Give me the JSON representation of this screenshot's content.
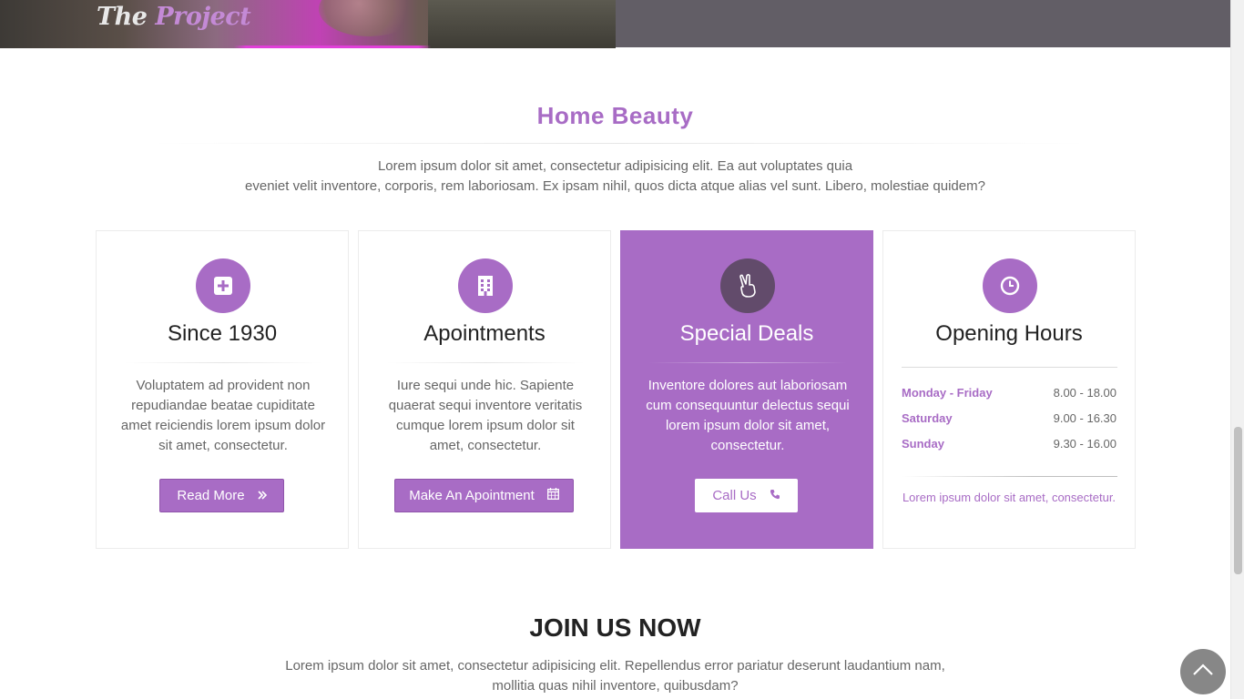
{
  "header": {
    "logo_part1": "The ",
    "logo_part2": "Project"
  },
  "section": {
    "title": "Home Beauty",
    "intro_line1": "Lorem ipsum dolor sit amet, consectetur adipisicing elit. Ea aut voluptates quia",
    "intro_line2": "eveniet velit inventore, corporis, rem laboriosam. Ex ipsam nihil, quos dicta atque alias vel sunt. Libero, molestiae quidem?"
  },
  "boxes": [
    {
      "icon": "plus-square-icon",
      "title": "Since 1930",
      "text": "Voluptatem ad provident non repudiandae beatae cupiditate amet reiciendis lorem ipsum dolor sit amet, consectetur.",
      "button_label": "Read More",
      "button_icon": "double-chevron-right-icon"
    },
    {
      "icon": "building-icon",
      "title": "Apointments",
      "text": "Iure sequi unde hic. Sapiente quaerat sequi inventore veritatis cumque lorem ipsum dolor sit amet, consectetur.",
      "button_label": "Make An Apointment",
      "button_icon": "calendar-icon"
    },
    {
      "icon": "hand-peace-icon",
      "title": "Special Deals",
      "text": "Inventore dolores aut laboriosam cum consequuntur delectus sequi lorem ipsum dolor sit amet, consectetur.",
      "button_label": "Call Us",
      "button_icon": "phone-icon"
    },
    {
      "icon": "clock-icon",
      "title": "Opening Hours",
      "hours": [
        {
          "day": "Monday - Friday",
          "time": "8.00 - 18.00"
        },
        {
          "day": "Saturday",
          "time": "9.00 - 16.30"
        },
        {
          "day": "Sunday",
          "time": "9.30 - 16.00"
        }
      ],
      "note": "Lorem ipsum dolor sit amet, consectetur."
    }
  ],
  "join": {
    "title": "JOIN US NOW",
    "text_line1": "Lorem ipsum dolor sit amet, consectetur adipisicing elit. Repellendus error pariatur deserunt laudantium nam,",
    "text_line2": "mollitia quas nihil inventore, quibusdam?"
  },
  "colors": {
    "accent": "#a86cc5",
    "accent_dark": "#624b6b",
    "banner_gray": "#625e66"
  },
  "back_to_top_icon": "chevron-up-icon"
}
